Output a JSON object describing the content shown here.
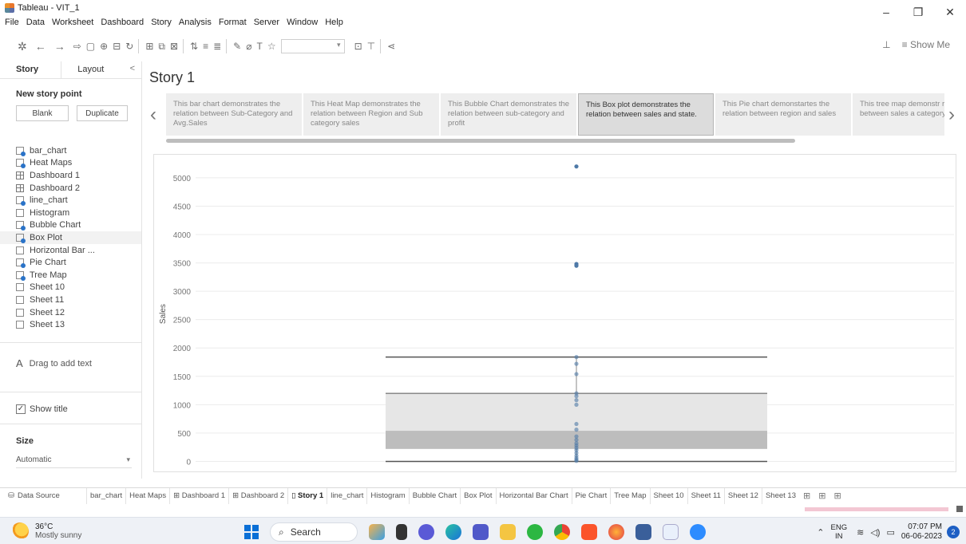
{
  "window": {
    "title": "Tableau - VIT_1",
    "minimize": "–",
    "maximize": "❐",
    "close": "✕"
  },
  "menu": [
    "File",
    "Data",
    "Worksheet",
    "Dashboard",
    "Story",
    "Analysis",
    "Format",
    "Server",
    "Window",
    "Help"
  ],
  "toolbar": {
    "show_me": "Show Me"
  },
  "left_pane": {
    "tabs": {
      "story": "Story",
      "layout": "Layout",
      "collapse": "<"
    },
    "new_story_point": "New story point",
    "blank": "Blank",
    "duplicate": "Duplicate",
    "sheets": [
      {
        "name": "bar_chart",
        "type": "worksheet"
      },
      {
        "name": "Heat Maps",
        "type": "worksheet"
      },
      {
        "name": "Dashboard 1",
        "type": "dashboard"
      },
      {
        "name": "Dashboard 2",
        "type": "dashboard"
      },
      {
        "name": "line_chart",
        "type": "worksheet"
      },
      {
        "name": "Histogram",
        "type": "sheet"
      },
      {
        "name": "Bubble Chart",
        "type": "worksheet"
      },
      {
        "name": "Box Plot",
        "type": "worksheet"
      },
      {
        "name": "Horizontal Bar ...",
        "type": "sheet"
      },
      {
        "name": "Pie Chart",
        "type": "worksheet"
      },
      {
        "name": "Tree Map",
        "type": "worksheet"
      },
      {
        "name": "Sheet 10",
        "type": "sheet"
      },
      {
        "name": "Sheet 11",
        "type": "sheet"
      },
      {
        "name": "Sheet 12",
        "type": "sheet"
      },
      {
        "name": "Sheet 13",
        "type": "sheet"
      }
    ],
    "drag_text": "Drag to add text",
    "drag_icon": "A",
    "show_title": "Show title",
    "size_heading": "Size",
    "size_value": "Automatic"
  },
  "story": {
    "title": "Story 1",
    "points": [
      "This bar chart demonstrates the relation between Sub-Category and Avg.Sales",
      "This Heat Map demonstrates the relation between Region and Sub category sales",
      "This Bubble Chart demonstrates the relation between sub-category and profit",
      "This Box plot demonstrates the relation between sales and state.",
      "This Pie chart demonstartes the relation between region and sales",
      "This tree map demonstr relation between sales a category"
    ],
    "active_index": 3
  },
  "chart_data": {
    "type": "box",
    "ylabel": "Sales",
    "ylim": [
      -120,
      5350
    ],
    "yticks": [
      0,
      500,
      1000,
      1500,
      2000,
      2500,
      3000,
      3500,
      4000,
      4500,
      5000
    ],
    "box": {
      "min": 0,
      "q1": 220,
      "median": 540,
      "q3": 1200,
      "max": 1840
    },
    "points": [
      5200,
      3480,
      3450,
      1840,
      1720,
      1540,
      1200,
      1150,
      1080,
      1000,
      660,
      560,
      440,
      380,
      320,
      280,
      240,
      200,
      150,
      100,
      60,
      30,
      10
    ],
    "colors": {
      "point": "#4e79a7",
      "box_upper": "#e6e6e6",
      "box_lower": "#bdbdbd",
      "whisker": "#555555",
      "grid": "#ececec"
    }
  },
  "bottom_tabs": {
    "data_source": "Data Source",
    "tabs": [
      {
        "label": "bar_chart",
        "icon": ""
      },
      {
        "label": "Heat Maps",
        "icon": ""
      },
      {
        "label": "Dashboard 1",
        "icon": "⊞"
      },
      {
        "label": "Dashboard 2",
        "icon": "⊞"
      },
      {
        "label": "Story 1",
        "icon": "▯"
      },
      {
        "label": "line_chart",
        "icon": ""
      },
      {
        "label": "Histogram",
        "icon": ""
      },
      {
        "label": "Bubble Chart",
        "icon": ""
      },
      {
        "label": "Box Plot",
        "icon": ""
      },
      {
        "label": "Horizontal Bar Chart",
        "icon": ""
      },
      {
        "label": "Pie Chart",
        "icon": ""
      },
      {
        "label": "Tree Map",
        "icon": ""
      },
      {
        "label": "Sheet 10",
        "icon": ""
      },
      {
        "label": "Sheet 11",
        "icon": ""
      },
      {
        "label": "Sheet 12",
        "icon": ""
      },
      {
        "label": "Sheet 13",
        "icon": ""
      }
    ],
    "active_index": 4
  },
  "taskbar": {
    "temperature": "36°C",
    "weather": "Mostly sunny",
    "search": "Search",
    "lang_top": "ENG",
    "lang_bottom": "IN",
    "time": "07:07 PM",
    "date": "06-06-2023",
    "notifications": "2"
  }
}
